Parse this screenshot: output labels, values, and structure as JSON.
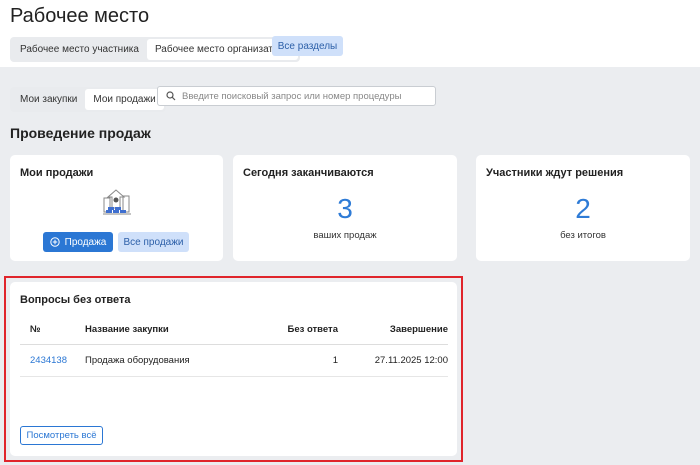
{
  "header": {
    "title": "Рабочее место",
    "tabs": [
      "Рабочее место участника",
      "Рабочее место организатора"
    ],
    "active_tab": 1,
    "all_sections": "Все разделы"
  },
  "filter": {
    "tabs": [
      "Мои закупки",
      "Мои продажи"
    ],
    "active_tab": 1,
    "search_placeholder": "Введите поисковый запрос или номер процедуры"
  },
  "section_title": "Проведение продаж",
  "cards": {
    "my_sales": {
      "title": "Мои продажи",
      "new_button": "Продажа",
      "all_button": "Все продажи"
    },
    "ending_today": {
      "title": "Сегодня заканчиваются",
      "value": "3",
      "caption": "ваших продаж"
    },
    "awaiting": {
      "title": "Участники ждут решения",
      "value": "2",
      "caption": "без итогов"
    }
  },
  "questions": {
    "title": "Вопросы без ответа",
    "columns": [
      "№",
      "Название закупки",
      "Без ответа",
      "Завершение"
    ],
    "rows": [
      {
        "id": "2434138",
        "name": "Продажа оборудования",
        "unanswered": "1",
        "end": "27.11.2025 12:00"
      }
    ],
    "view_all": "Посмотреть всё"
  },
  "colors": {
    "accent": "#2b77d4",
    "highlight": "#e0252b"
  }
}
